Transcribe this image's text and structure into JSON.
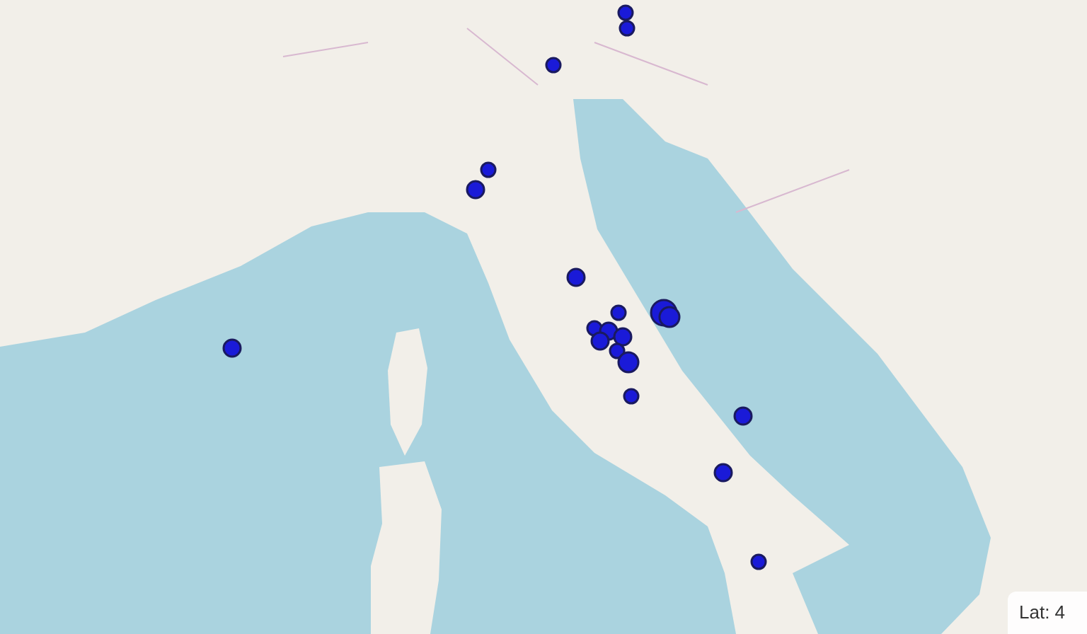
{
  "coordinates": {
    "text": "Lat: 4"
  }
}
